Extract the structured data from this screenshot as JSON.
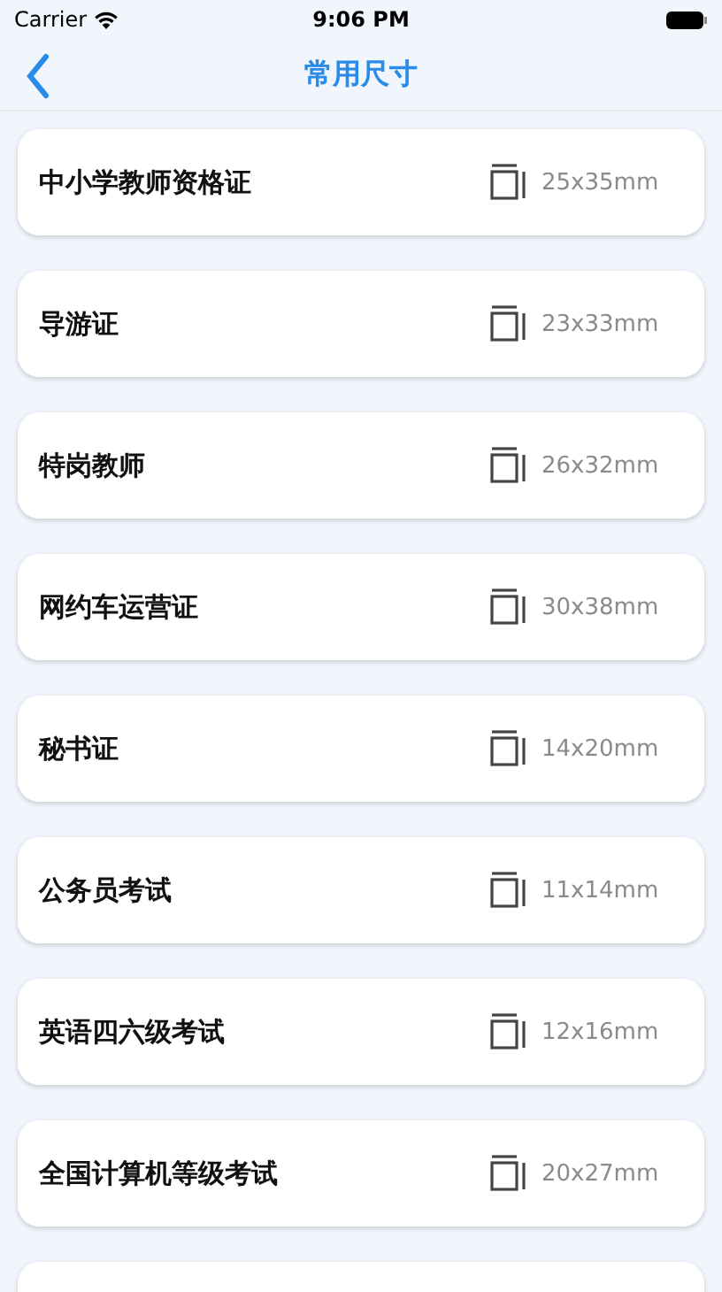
{
  "status_bar": {
    "carrier": "Carrier",
    "time": "9:06 PM"
  },
  "nav": {
    "title": "常用尺寸"
  },
  "items": [
    {
      "name": "中小学教师资格证",
      "size": "25x35mm"
    },
    {
      "name": "导游证",
      "size": "23x33mm"
    },
    {
      "name": "特岗教师",
      "size": "26x32mm"
    },
    {
      "name": "网约车运营证",
      "size": "30x38mm"
    },
    {
      "name": "秘书证",
      "size": "14x20mm"
    },
    {
      "name": "公务员考试",
      "size": "11x14mm"
    },
    {
      "name": "英语四六级考试",
      "size": "12x16mm"
    },
    {
      "name": "全国计算机等级考试",
      "size": "20x27mm"
    }
  ]
}
